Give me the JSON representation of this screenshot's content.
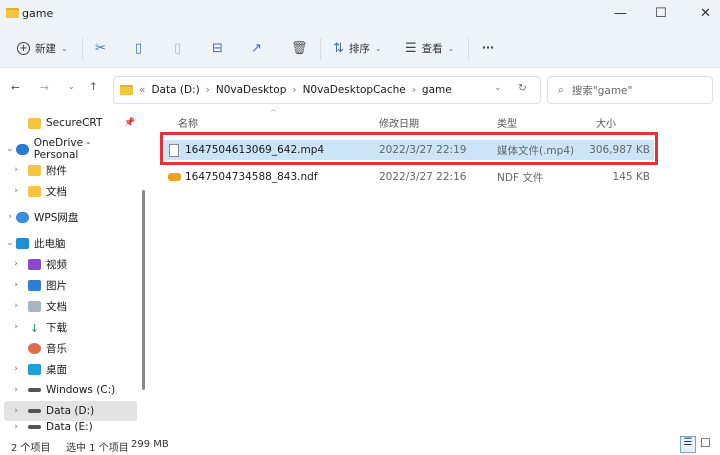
{
  "window": {
    "title": "game",
    "minimize_icon": "minimize",
    "maximize_icon": "maximize",
    "close_icon": "close"
  },
  "toolbar": {
    "new_label": "新建",
    "sort_label": "排序",
    "view_label": "查看",
    "more": "···"
  },
  "address": {
    "segments": [
      "Data (D:)",
      "N0vaDesktop",
      "N0vaDesktopCache",
      "game"
    ],
    "overflow": "«"
  },
  "search": {
    "placeholder": "搜索\"game\""
  },
  "sidebar": {
    "items": [
      {
        "label": "SecureCRT"
      },
      {
        "label": "OneDrive - Personal"
      },
      {
        "label": "附件"
      },
      {
        "label": "文档"
      },
      {
        "label": "WPS网盘"
      },
      {
        "label": "此电脑"
      },
      {
        "label": "视频"
      },
      {
        "label": "图片"
      },
      {
        "label": "文档"
      },
      {
        "label": "下载"
      },
      {
        "label": "音乐"
      },
      {
        "label": "桌面"
      },
      {
        "label": "Windows (C:)"
      },
      {
        "label": "Data (D:)"
      },
      {
        "label": "Data (E:)"
      }
    ]
  },
  "columns": {
    "name": "名称",
    "date": "修改日期",
    "type": "类型",
    "size": "大小"
  },
  "files": [
    {
      "name": "1647504613069_642.mp4",
      "date": "2022/3/27 22:19",
      "type": "媒体文件(.mp4)",
      "size": "306,987 KB"
    },
    {
      "name": "1647504734588_843.ndf",
      "date": "2022/3/27 22:16",
      "type": "NDF 文件",
      "size": "145 KB"
    }
  ],
  "status": {
    "count": "2 个项目",
    "selected": "选中 1 个项目",
    "size": "299 MB"
  },
  "colors": {
    "highlight_box": "#e8303a",
    "selection": "#cce4f7"
  }
}
